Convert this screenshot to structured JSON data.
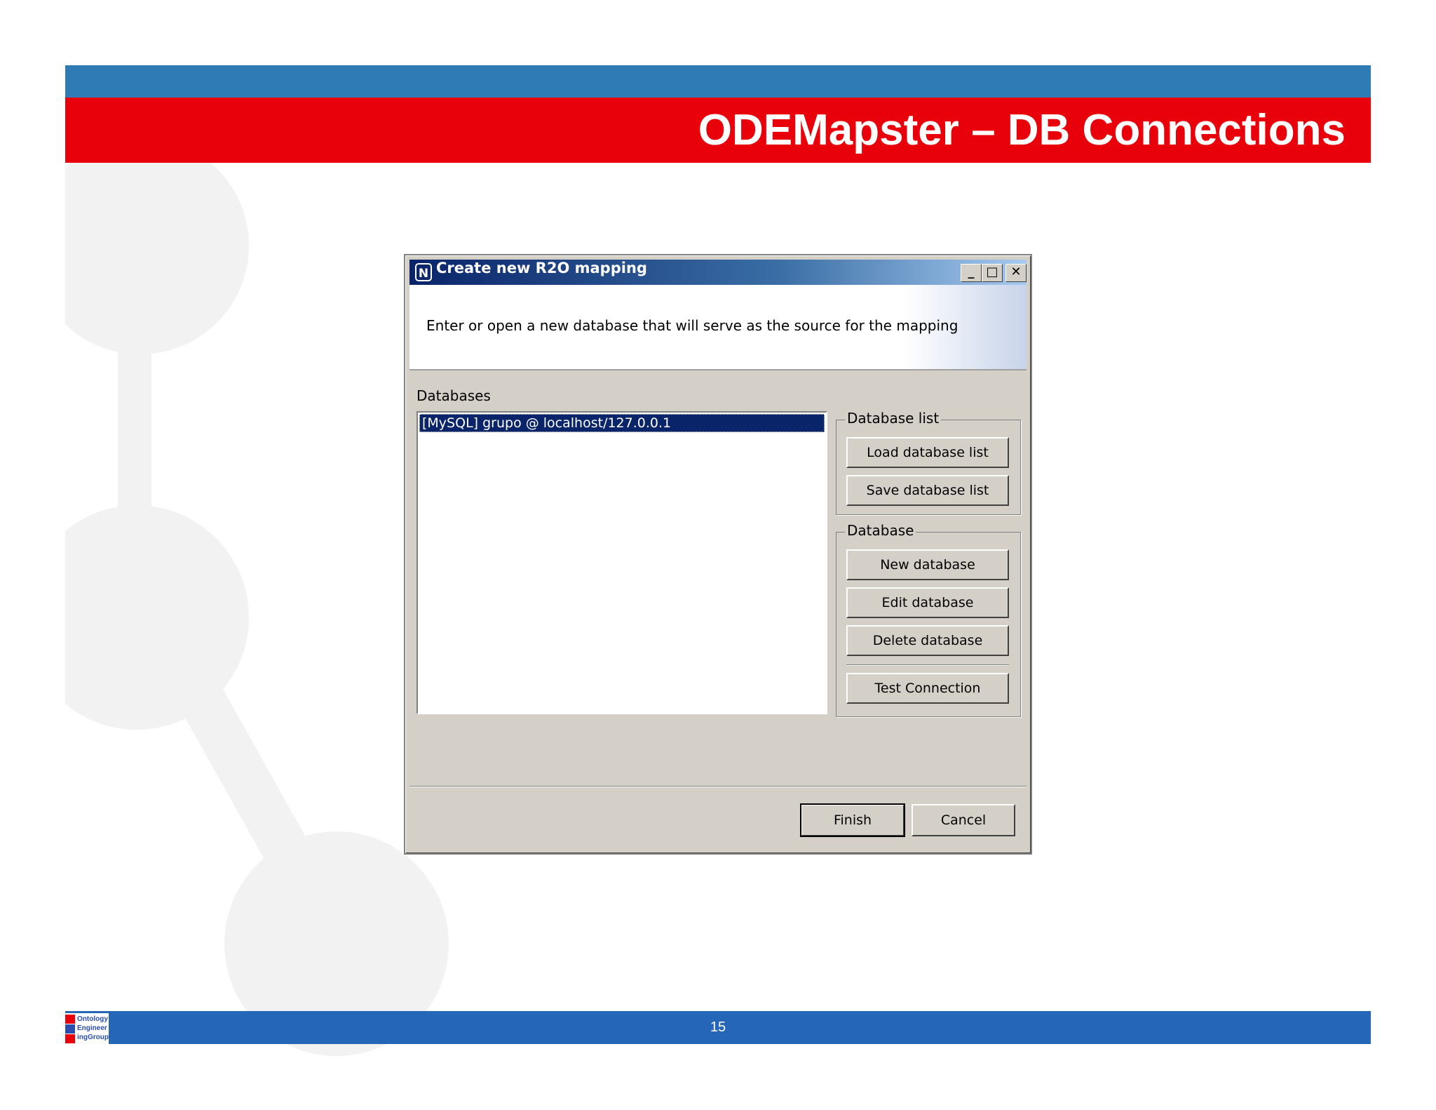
{
  "slide": {
    "title": "ODEMapster – DB Connections",
    "page_number": "15",
    "logo_text": [
      "Ontology",
      "Engineer",
      "ingGroup"
    ]
  },
  "dialog": {
    "title": "Create new R2O mapping",
    "app_icon": "N",
    "window_buttons": {
      "minimize": "_",
      "maximize": "□",
      "close": "✕"
    },
    "instruction": "Enter or open a new database that will serve as the source for the mapping",
    "databases_label": "Databases",
    "databases": [
      "[MySQL] grupo @ localhost/127.0.0.1"
    ],
    "database_list_group": {
      "legend": "Database list",
      "load_label": "Load database list",
      "save_label": "Save database list"
    },
    "database_group": {
      "legend": "Database",
      "new_label": "New database",
      "edit_label": "Edit database",
      "delete_label": "Delete database",
      "test_label": "Test Connection"
    },
    "finish_label": "Finish",
    "cancel_label": "Cancel"
  },
  "colors": {
    "top_band": "#2e7bb6",
    "title_band": "#e8000b",
    "footer_band": "#2566b8",
    "dialog_face": "#d4d0c8",
    "selection": "#0a246a"
  }
}
